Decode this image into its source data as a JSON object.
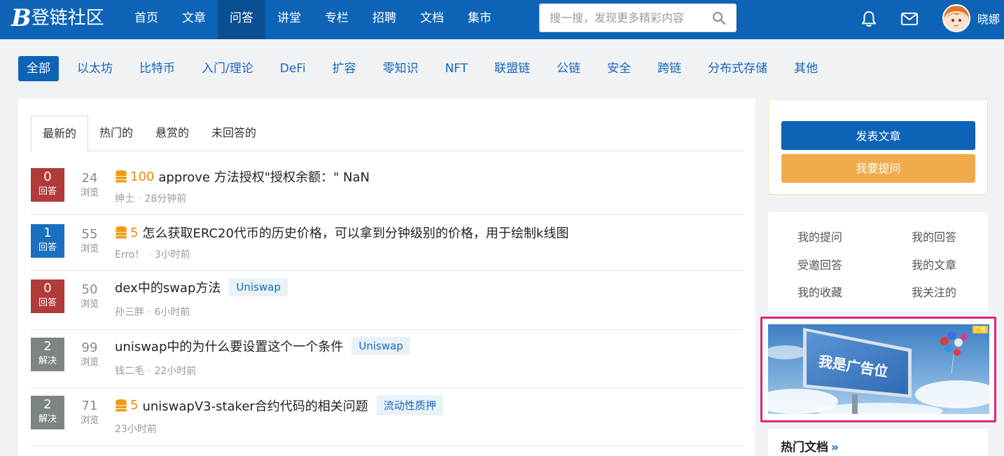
{
  "header": {
    "logo": {
      "mark": "B",
      "text": "登链社区"
    },
    "nav": [
      {
        "label": "首页"
      },
      {
        "label": "文章"
      },
      {
        "label": "问答",
        "active": true
      },
      {
        "label": "讲堂"
      },
      {
        "label": "专栏"
      },
      {
        "label": "招聘"
      },
      {
        "label": "文档"
      },
      {
        "label": "集市"
      }
    ],
    "search": {
      "placeholder": "搜一搜，发现更多精彩内容"
    },
    "username": "晓娜"
  },
  "categories": [
    {
      "label": "全部",
      "active": true
    },
    {
      "label": "以太坊"
    },
    {
      "label": "比特币"
    },
    {
      "label": "入门/理论"
    },
    {
      "label": "DeFi"
    },
    {
      "label": "扩容"
    },
    {
      "label": "零知识"
    },
    {
      "label": "NFT"
    },
    {
      "label": "联盟链"
    },
    {
      "label": "公链"
    },
    {
      "label": "安全"
    },
    {
      "label": "跨链"
    },
    {
      "label": "分布式存储"
    },
    {
      "label": "其他"
    }
  ],
  "tabs": [
    {
      "label": "最新的",
      "active": true
    },
    {
      "label": "热门的"
    },
    {
      "label": "悬赏的"
    },
    {
      "label": "未回答的"
    }
  ],
  "questions": [
    {
      "answers": "0",
      "answer_label": "回答",
      "state": "red",
      "views": "24",
      "views_label": "浏览",
      "reward": "100",
      "title": "approve 方法授权\"授权余额：\" NaN",
      "tag": "",
      "author": "绅士",
      "sep": "·",
      "time": "28分钟前"
    },
    {
      "answers": "1",
      "answer_label": "回答",
      "state": "blue",
      "views": "55",
      "views_label": "浏览",
      "reward": "5",
      "title": "怎么获取ERC20代币的历史价格，可以拿到分钟级别的价格，用于绘制k线图",
      "tag": "",
      "author": "Erro！",
      "sep": "·",
      "time": "3小时前"
    },
    {
      "answers": "0",
      "answer_label": "回答",
      "state": "red",
      "views": "50",
      "views_label": "浏览",
      "reward": "",
      "title": "dex中的swap方法",
      "tag": "Uniswap",
      "author": "孙三胖",
      "sep": "·",
      "time": "6小时前"
    },
    {
      "answers": "2",
      "answer_label": "解决",
      "state": "gray",
      "views": "99",
      "views_label": "浏览",
      "reward": "",
      "title": "uniswap中的为什么要设置这个一个条件",
      "tag": "Uniswap",
      "author": "钱二毛",
      "sep": "·",
      "time": "22小时前"
    },
    {
      "answers": "2",
      "answer_label": "解决",
      "state": "gray",
      "views": "71",
      "views_label": "浏览",
      "reward": "5",
      "title": "uniswapV3-staker合约代码的相关问题",
      "tag": "流动性质押",
      "author": "",
      "sep": "",
      "time": "23小时前"
    }
  ],
  "sidebar": {
    "publish_article": "发表文章",
    "ask_question": "我要提问",
    "links": [
      "我的提问",
      "我的回答",
      "受邀回答",
      "我的文章",
      "我的收藏",
      "我关注的"
    ],
    "ad": {
      "text": "我是广告位",
      "badge": "广告"
    },
    "hot_docs": "热门文档",
    "hot_docs_more": "»"
  },
  "colors": {
    "primary": "#0d64b6",
    "warn": "#f0ac4b",
    "reward": "#f08a0a",
    "ad_border": "#e0247b"
  }
}
